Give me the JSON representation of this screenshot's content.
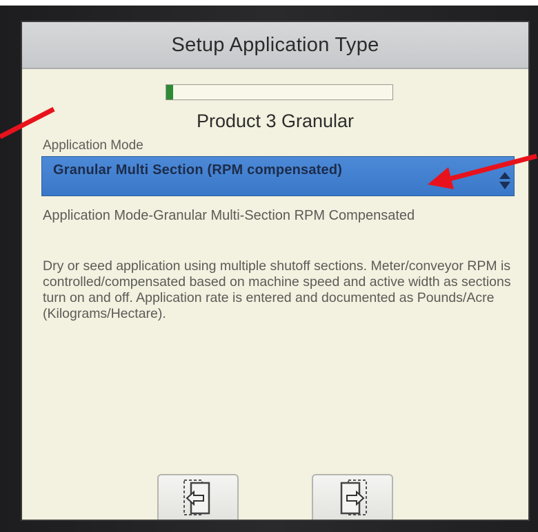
{
  "screen": {
    "title": "Setup Application Type",
    "progress_fraction": 0.03,
    "product_name": "Product 3 Granular",
    "mode_label": "Application Mode",
    "mode_selected": "Granular Multi Section (RPM compensated)",
    "description_title": "Application Mode-Granular Multi-Section RPM Compensated",
    "description_body": "Dry or seed application using multiple shutoff sections.  Meter/conveyor RPM is controlled/compensated based on machine speed and active width as sections turn on and off. Application rate is entered and documented as Pounds/Acre (Kilograms/Hectare)."
  },
  "colors": {
    "screen_bg": "#f3f1df",
    "title_bar": "#c6c8cb",
    "dropdown_bg": "#3a77c8",
    "progress_fill": "#2f8a36",
    "annotation_arrow": "#e8121c"
  },
  "icons": {
    "prev_button": "previous-page-icon",
    "next_button": "next-page-icon",
    "dropdown": "up-down-arrows-icon"
  }
}
